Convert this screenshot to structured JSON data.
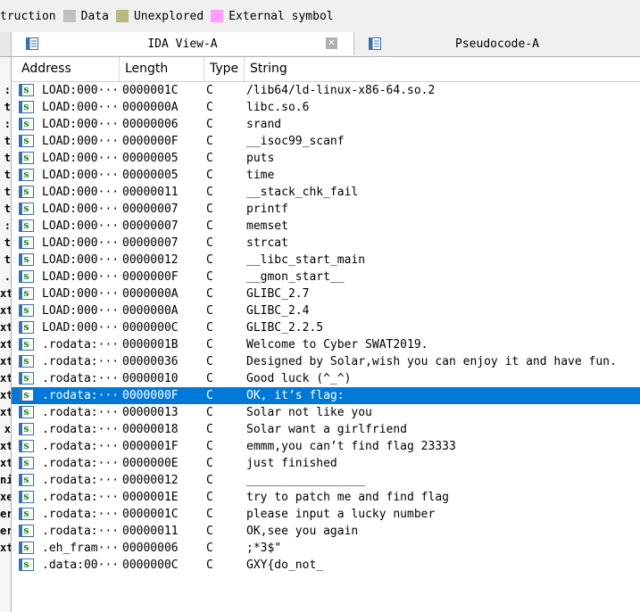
{
  "legend": {
    "items": [
      {
        "label": "truction",
        "color": ""
      },
      {
        "label": "Data",
        "color": "#c0c0c0"
      },
      {
        "label": "Unexplored",
        "color": "#b8b880"
      },
      {
        "label": "External symbol",
        "color": "#ff9cff"
      }
    ]
  },
  "tabs": [
    {
      "title": "IDA View-A",
      "active": true,
      "close": "✕"
    },
    {
      "title": "Pseudocode-A",
      "active": false
    }
  ],
  "gutter": [
    "",
    ":",
    "t",
    ":",
    "t",
    "t",
    "t",
    "t",
    "t",
    ":",
    "t",
    "t",
    ".",
    "xt",
    "xt",
    "xt",
    "xt",
    "xt",
    "xt",
    "xt",
    "xt",
    "x",
    "xt",
    "xt",
    "ni",
    "xe",
    "er",
    "er",
    "xt",
    ""
  ],
  "table": {
    "headers": {
      "address": "Address",
      "length": "Length",
      "type": "Type",
      "string": "String"
    },
    "icon_label": "s",
    "rows": [
      {
        "address": "LOAD:000···",
        "length": "0000001C",
        "type": "C",
        "string": "/lib64/ld-linux-x86-64.so.2"
      },
      {
        "address": "LOAD:000···",
        "length": "0000000A",
        "type": "C",
        "string": "libc.so.6"
      },
      {
        "address": "LOAD:000···",
        "length": "00000006",
        "type": "C",
        "string": "srand"
      },
      {
        "address": "LOAD:000···",
        "length": "0000000F",
        "type": "C",
        "string": "__isoc99_scanf"
      },
      {
        "address": "LOAD:000···",
        "length": "00000005",
        "type": "C",
        "string": "puts"
      },
      {
        "address": "LOAD:000···",
        "length": "00000005",
        "type": "C",
        "string": "time"
      },
      {
        "address": "LOAD:000···",
        "length": "00000011",
        "type": "C",
        "string": "__stack_chk_fail"
      },
      {
        "address": "LOAD:000···",
        "length": "00000007",
        "type": "C",
        "string": "printf"
      },
      {
        "address": "LOAD:000···",
        "length": "00000007",
        "type": "C",
        "string": "memset"
      },
      {
        "address": "LOAD:000···",
        "length": "00000007",
        "type": "C",
        "string": "strcat"
      },
      {
        "address": "LOAD:000···",
        "length": "00000012",
        "type": "C",
        "string": "__libc_start_main"
      },
      {
        "address": "LOAD:000···",
        "length": "0000000F",
        "type": "C",
        "string": "__gmon_start__"
      },
      {
        "address": "LOAD:000···",
        "length": "0000000A",
        "type": "C",
        "string": "GLIBC_2.7"
      },
      {
        "address": "LOAD:000···",
        "length": "0000000A",
        "type": "C",
        "string": "GLIBC_2.4"
      },
      {
        "address": "LOAD:000···",
        "length": "0000000C",
        "type": "C",
        "string": "GLIBC_2.2.5"
      },
      {
        "address": ".rodata:···",
        "length": "0000001B",
        "type": "C",
        "string": "Welcome to Cyber SWAT2019."
      },
      {
        "address": ".rodata:···",
        "length": "00000036",
        "type": "C",
        "string": "Designed by Solar,wish you can enjoy it and have fun."
      },
      {
        "address": ".rodata:···",
        "length": "00000010",
        "type": "C",
        "string": "Good luck (^_^)"
      },
      {
        "address": ".rodata:···",
        "length": "0000000F",
        "type": "C",
        "string": "OK, it’s flag:",
        "selected": true
      },
      {
        "address": ".rodata:···",
        "length": "00000013",
        "type": "C",
        "string": "Solar not like you"
      },
      {
        "address": ".rodata:···",
        "length": "00000018",
        "type": "C",
        "string": "Solar want a girlfriend"
      },
      {
        "address": ".rodata:···",
        "length": "0000001F",
        "type": "C",
        "string": "emmm,you can’t find flag 23333"
      },
      {
        "address": ".rodata:···",
        "length": "0000000E",
        "type": "C",
        "string": "just finished"
      },
      {
        "address": ".rodata:···",
        "length": "00000012",
        "type": "C",
        "string": "_________________"
      },
      {
        "address": ".rodata:···",
        "length": "0000001E",
        "type": "C",
        "string": "try to patch me and find flag"
      },
      {
        "address": ".rodata:···",
        "length": "0000001C",
        "type": "C",
        "string": "please input a lucky number"
      },
      {
        "address": ".rodata:···",
        "length": "00000011",
        "type": "C",
        "string": "OK,see you again"
      },
      {
        "address": ".eh_fram···",
        "length": "00000006",
        "type": "C",
        "string": ";*3$\""
      },
      {
        "address": ".data:00···",
        "length": "0000000C",
        "type": "C",
        "string": "GXY{do_not_"
      }
    ]
  }
}
